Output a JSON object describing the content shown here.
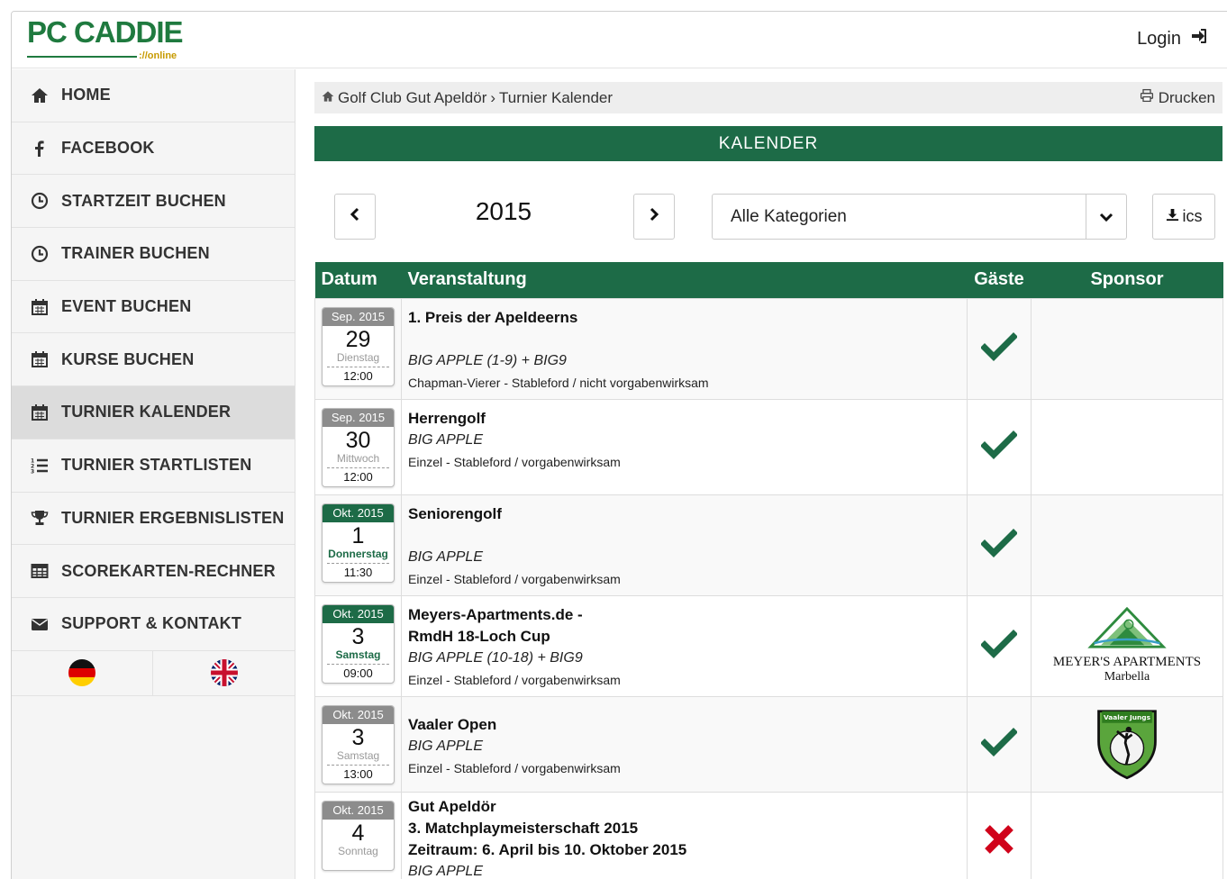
{
  "header": {
    "logo_text": "PC CADDIE",
    "logo_sub": "://online",
    "login_label": "Login"
  },
  "sidebar": {
    "items": [
      {
        "label": "HOME",
        "icon": "home-icon"
      },
      {
        "label": "FACEBOOK",
        "icon": "facebook-icon"
      },
      {
        "label": "STARTZEIT BUCHEN",
        "icon": "clock-icon"
      },
      {
        "label": "TRAINER BUCHEN",
        "icon": "clock-icon"
      },
      {
        "label": "EVENT BUCHEN",
        "icon": "calendar-icon"
      },
      {
        "label": "KURSE BUCHEN",
        "icon": "calendar-icon"
      },
      {
        "label": "TURNIER KALENDER",
        "icon": "calendar-icon",
        "active": true
      },
      {
        "label": "TURNIER STARTLISTEN",
        "icon": "numbered-list-icon"
      },
      {
        "label": "TURNIER ERGEBNISLISTEN",
        "icon": "trophy-icon"
      },
      {
        "label": "SCOREKARTEN-RECHNER",
        "icon": "table-icon"
      },
      {
        "label": "SUPPORT & KONTAKT",
        "icon": "envelope-icon"
      }
    ],
    "languages": [
      "german-flag-icon",
      "uk-flag-icon"
    ]
  },
  "breadcrumb": {
    "club": "Golf Club Gut Apeldör",
    "separator": "›",
    "page": "Turnier Kalender",
    "print_label": "Drucken"
  },
  "calendar": {
    "title": "KALENDER",
    "year": "2015",
    "category_selected": "Alle Kategorien",
    "ics_label": "ics"
  },
  "table": {
    "headers": {
      "date": "Datum",
      "event": "Veranstaltung",
      "guests": "Gäste",
      "sponsor": "Sponsor"
    },
    "rows": [
      {
        "month": "Sep. 2015",
        "day": "29",
        "weekday": "Dienstag",
        "time": "12:00",
        "upcoming": false,
        "title": "1. Preis der Apeldeerns",
        "category": "BIG APPLE (1-9) + BIG9",
        "mode": "Chapman-Vierer - Stableford / nicht vorgabenwirksam",
        "guests": true,
        "sponsor": ""
      },
      {
        "month": "Sep. 2015",
        "day": "30",
        "weekday": "Mittwoch",
        "time": "12:00",
        "upcoming": false,
        "title": "Herrengolf",
        "category": "BIG APPLE",
        "mode": "Einzel - Stableford / vorgabenwirksam",
        "guests": true,
        "sponsor": ""
      },
      {
        "month": "Okt. 2015",
        "day": "1",
        "weekday": "Donnerstag",
        "time": "11:30",
        "upcoming": true,
        "title": "Seniorengolf",
        "category": "BIG APPLE",
        "mode": "Einzel - Stableford / vorgabenwirksam",
        "guests": true,
        "sponsor": ""
      },
      {
        "month": "Okt. 2015",
        "day": "3",
        "weekday": "Samstag",
        "time": "09:00",
        "upcoming": true,
        "title_line1": "Meyers-Apartments.de -",
        "title_line2": "RmdH 18-Loch Cup",
        "category": "BIG APPLE (10-18) + BIG9",
        "mode": "Einzel - Stableford / vorgabenwirksam",
        "guests": true,
        "sponsor_name": "MEYER'S APARTMENTS",
        "sponsor_city": "Marbella"
      },
      {
        "month": "Okt. 2015",
        "day": "3",
        "weekday": "Samstag",
        "time": "13:00",
        "upcoming": false,
        "title": "Vaaler Open",
        "category": "BIG APPLE",
        "mode": "Einzel - Stableford / vorgabenwirksam",
        "guests": true,
        "sponsor_badge": "Vaaler Jungs"
      },
      {
        "month": "Okt. 2015",
        "day": "4",
        "weekday": "Sonntag",
        "time": "",
        "upcoming": false,
        "title_line1": "Gut Apeldör",
        "title_line2": "3. Matchplaymeisterschaft 2015",
        "title_line3": "Zeitraum: 6. April bis 10. Oktober 2015",
        "category": "BIG APPLE",
        "guests": false
      }
    ]
  },
  "colors": {
    "brand_green": "#1d6b47",
    "check_green": "#1d6b47",
    "cross_red": "#d0021b"
  }
}
